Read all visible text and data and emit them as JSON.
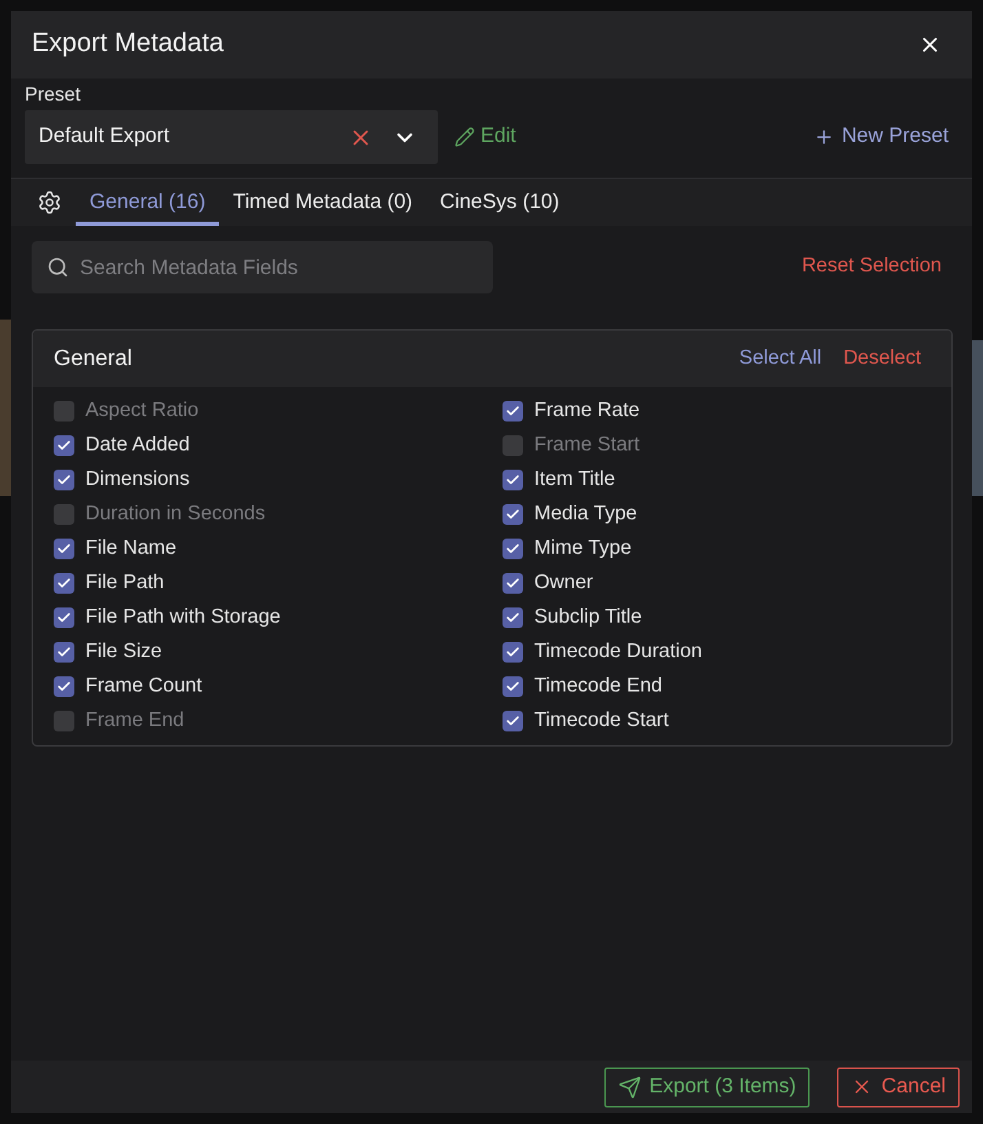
{
  "dialog": {
    "title": "Export Metadata"
  },
  "preset": {
    "label": "Preset",
    "value": "Default Export",
    "edit_button": "Edit",
    "new_button": "New Preset"
  },
  "tabs": [
    {
      "label": "General (16)",
      "selected": true
    },
    {
      "label": "Timed Metadata (0)",
      "selected": false
    },
    {
      "label": "CineSys (10)",
      "selected": false
    }
  ],
  "search": {
    "placeholder": "Search Metadata Fields"
  },
  "reset_button": "Reset Selection",
  "section": {
    "title": "General",
    "select_all": "Select All",
    "deselect": "Deselect",
    "columns": [
      [
        {
          "label": "Aspect Ratio",
          "checked": false
        },
        {
          "label": "Date Added",
          "checked": true
        },
        {
          "label": "Dimensions",
          "checked": true
        },
        {
          "label": "Duration in Seconds",
          "checked": false
        },
        {
          "label": "File Name",
          "checked": true
        },
        {
          "label": "File Path",
          "checked": true
        },
        {
          "label": "File Path with Storage",
          "checked": true
        },
        {
          "label": "File Size",
          "checked": true
        },
        {
          "label": "Frame Count",
          "checked": true
        },
        {
          "label": "Frame End",
          "checked": false
        }
      ],
      [
        {
          "label": "Frame Rate",
          "checked": true
        },
        {
          "label": "Frame Start",
          "checked": false
        },
        {
          "label": "Item Title",
          "checked": true
        },
        {
          "label": "Media Type",
          "checked": true
        },
        {
          "label": "Mime Type",
          "checked": true
        },
        {
          "label": "Owner",
          "checked": true
        },
        {
          "label": "Subclip Title",
          "checked": true
        },
        {
          "label": "Timecode Duration",
          "checked": true
        },
        {
          "label": "Timecode End",
          "checked": true
        },
        {
          "label": "Timecode Start",
          "checked": true
        }
      ]
    ]
  },
  "buttons": [
    {
      "kind": "export",
      "label": "Export (3 Items)"
    },
    {
      "kind": "cancel",
      "label": "Cancel"
    }
  ]
}
